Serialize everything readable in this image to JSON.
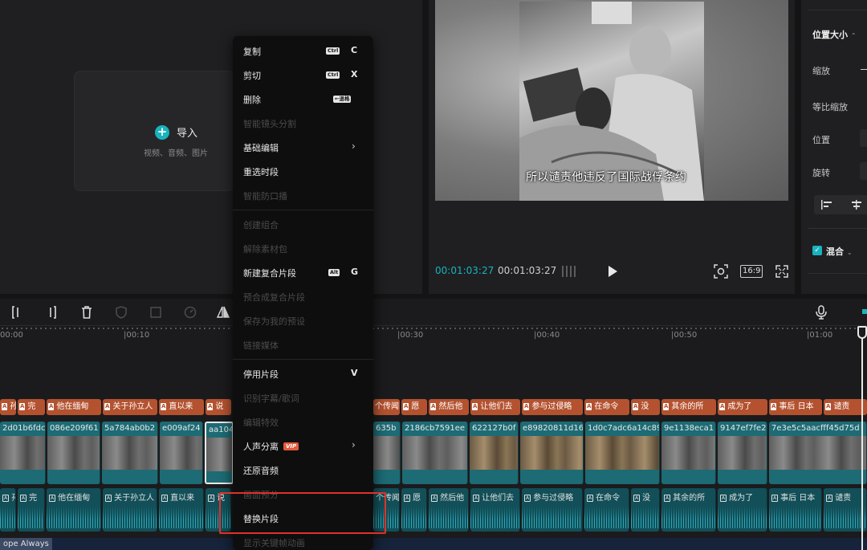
{
  "media": {
    "import_label": "导入",
    "import_sub": "视频、音频、图片"
  },
  "player": {
    "subtitle": "所以谴责他违反了国际战俘条约",
    "time_current": "00:01:03:27",
    "time_total": "00:01:03:27",
    "ratio": "16:9",
    "accent_color": "#19b3bd"
  },
  "properties": {
    "section": "位置大小",
    "scale_label": "缩放",
    "uniform_scale_label": "等比缩放",
    "position_label": "位置",
    "rotate_label": "旋转",
    "blend_label": "混合"
  },
  "timeline": {
    "ruler_ticks": [
      "00:00",
      "|00:10",
      "|00:30",
      "|00:40",
      "|00:50",
      "|01:00"
    ],
    "text_clips": [
      "孙",
      "完",
      "他在缅甸",
      "关于孙立人",
      "直以来",
      "说",
      "个传闻",
      "愿",
      "然后他",
      "让他们去",
      "参与过侵略",
      "在命令",
      "没",
      "其余的所",
      "成为了",
      "事后 日本",
      "谴责"
    ],
    "video_clips": [
      "2d01b6fdc",
      "086e209f61",
      "5a784ab0b2",
      "e009af24",
      "aa104",
      "635b",
      "2186cb7591ee",
      "622127b0f",
      "e89820811d16",
      "1d0c7adc6a14c89",
      "9e1138eca1",
      "9147ef7fe2",
      "7e3e5c5aacfff45d75d"
    ],
    "audio_clips": [
      "孙",
      "完",
      "他在缅甸",
      "关于孙立人",
      "直以来",
      "说",
      "个传闻",
      "愿",
      "然后他",
      "让他们去",
      "参与过侵略",
      "在命令",
      "没",
      "其余的所",
      "成为了",
      "事后 日本",
      "谴责"
    ],
    "status_label": "ope Always",
    "text_clip_color": "#b4522f",
    "video_clip_color": "#1d6b74",
    "audio_clip_color": "#124f58"
  },
  "context_menu": {
    "items": [
      {
        "label": "复制",
        "kbd": "Ctrl",
        "key": "C",
        "enabled": true
      },
      {
        "label": "剪切",
        "kbd": "Ctrl",
        "key": "X",
        "enabled": true
      },
      {
        "label": "删除",
        "kbd": "←退格",
        "key": "",
        "enabled": true
      },
      {
        "label": "智能镜头分割",
        "enabled": false
      },
      {
        "label": "基础编辑",
        "submenu": true,
        "enabled": true
      },
      {
        "label": "重选时段",
        "enabled": true
      },
      {
        "label": "智能防口播",
        "enabled": false
      },
      {
        "label": "创建组合",
        "enabled": false
      },
      {
        "label": "解除素材包",
        "enabled": false
      },
      {
        "label": "新建复合片段",
        "kbd": "Alt",
        "key": "G",
        "enabled": true
      },
      {
        "label": "预合成复合片段",
        "enabled": false
      },
      {
        "label": "保存为我的预设",
        "enabled": false
      },
      {
        "label": "链接媒体",
        "enabled": false
      },
      {
        "label": "停用片段",
        "key": "V",
        "enabled": true
      },
      {
        "label": "识别字幕/歌词",
        "enabled": false
      },
      {
        "label": "编辑特效",
        "enabled": false
      },
      {
        "label": "人声分离",
        "badge": "VIP",
        "submenu": true,
        "enabled": true
      },
      {
        "label": "还原音频",
        "enabled": true
      },
      {
        "label": "画面预分",
        "enabled": false
      },
      {
        "label": "替换片段",
        "enabled": true
      },
      {
        "label": "显示关键帧动画",
        "enabled": false
      }
    ],
    "highlight_color": "#e0322a"
  }
}
